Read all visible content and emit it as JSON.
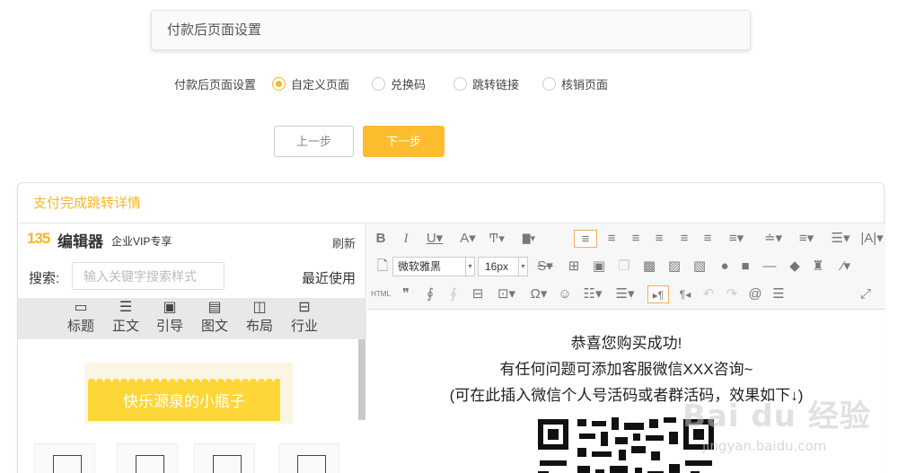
{
  "header": {
    "title": "付款后页面设置"
  },
  "settings": {
    "label": "付款后页面设置",
    "options": [
      {
        "label": "自定义页面",
        "checked": true
      },
      {
        "label": "兑换码",
        "checked": false
      },
      {
        "label": "跳转链接",
        "checked": false
      },
      {
        "label": "核销页面",
        "checked": false
      }
    ]
  },
  "buttons": {
    "prev": "上一步",
    "next": "下一步"
  },
  "panel": {
    "title": "支付完成跳转详情"
  },
  "left": {
    "logo_mark": "135",
    "logo_name": "编辑器",
    "logo_sub": "企业VIP专享",
    "refresh": "刷新",
    "search_label": "搜索:",
    "search_placeholder": "输入关键字搜索样式",
    "recent": "最近使用",
    "categories": [
      {
        "label": "标题",
        "icon": "title-icon"
      },
      {
        "label": "正文",
        "icon": "text-icon"
      },
      {
        "label": "引导",
        "icon": "guide-icon"
      },
      {
        "label": "图文",
        "icon": "image-text-icon"
      },
      {
        "label": "布局",
        "icon": "layout-icon"
      },
      {
        "label": "行业",
        "icon": "industry-icon"
      }
    ],
    "template_banner": "快乐源泉的小瓶子"
  },
  "toolbar": {
    "font_family": "微软雅黑",
    "font_size": "16px"
  },
  "editor": {
    "lines": [
      "恭喜您购买成功!",
      "有任何问题可添加客服微信XXX咨询~",
      "(可在此插入微信个人号活码或者群活码，效果如下↓)"
    ]
  },
  "watermark": {
    "main": "Bai du 经验",
    "sub": "jingyan.baidu.com"
  },
  "colors": {
    "accent": "#fbbd2e",
    "title_accent": "#f5b727",
    "banner": "#fdd637"
  }
}
